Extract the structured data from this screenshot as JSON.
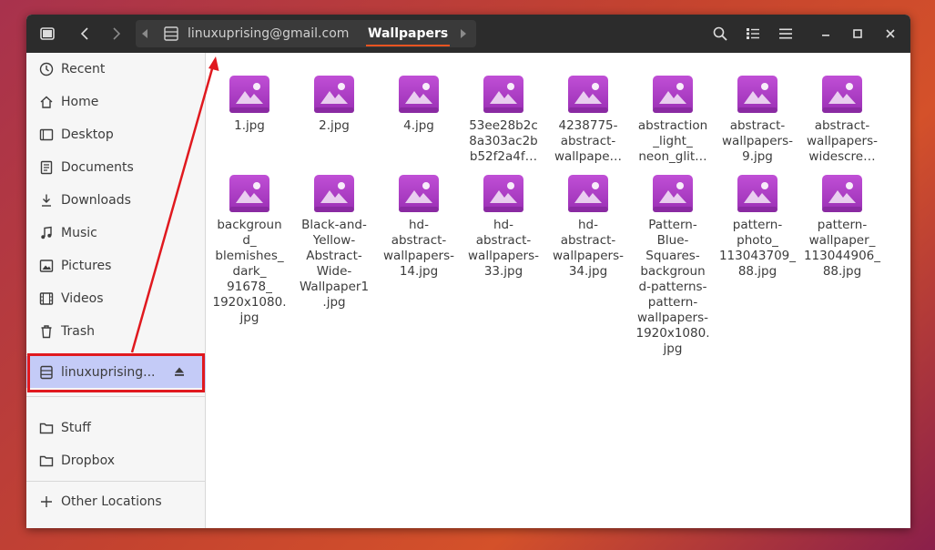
{
  "path": {
    "parent": "linuxuprising@gmail.com",
    "current": "Wallpapers"
  },
  "sidebar": {
    "items": [
      {
        "label": "Recent",
        "icon": "clock-icon"
      },
      {
        "label": "Home",
        "icon": "home-icon"
      },
      {
        "label": "Desktop",
        "icon": "desktop-icon"
      },
      {
        "label": "Documents",
        "icon": "documents-icon"
      },
      {
        "label": "Downloads",
        "icon": "downloads-icon"
      },
      {
        "label": "Music",
        "icon": "music-icon"
      },
      {
        "label": "Pictures",
        "icon": "pictures-icon"
      },
      {
        "label": "Videos",
        "icon": "videos-icon"
      },
      {
        "label": "Trash",
        "icon": "trash-icon"
      }
    ],
    "mount": {
      "label": "linuxuprising...",
      "icon": "drive-icon",
      "eject_icon": "eject-icon"
    },
    "bookmarks": [
      {
        "label": "Stuff",
        "icon": "folder-icon"
      },
      {
        "label": "Dropbox",
        "icon": "folder-icon"
      }
    ],
    "other": {
      "label": "Other Locations",
      "icon": "plus-icon"
    }
  },
  "files": [
    "1.jpg",
    "2.jpg",
    "4.jpg",
    "53ee28b2c\n8a303ac2b\nb52f2a4f…",
    "4238775-\nabstract-\nwallpape…",
    "abstraction\n_light_\nneon_glit…",
    "abstract-\nwallpapers-\n9.jpg",
    "abstract-\nwallpapers-\nwidescre…",
    "backgroun\nd_\nblemishes_\ndark_\n91678_\n1920x1080.\njpg",
    "Black-and-\nYellow-\nAbstract-\nWide-\nWallpaper1\n.jpg",
    "hd-\nabstract-\nwallpapers-\n14.jpg",
    "hd-\nabstract-\nwallpapers-\n33.jpg",
    "hd-\nabstract-\nwallpapers-\n34.jpg",
    "Pattern-\nBlue-\nSquares-\nbackgroun\nd-patterns-\npattern-\nwallpapers-\n1920x1080.\njpg",
    "pattern-\nphoto_\n113043709_\n88.jpg",
    "pattern-\nwallpaper_\n113044906_\n88.jpg"
  ],
  "colors": {
    "accent": "#e95420",
    "thumb": "#b040c8",
    "annotation": "#e0191f",
    "selected": "#c4cbf7"
  }
}
